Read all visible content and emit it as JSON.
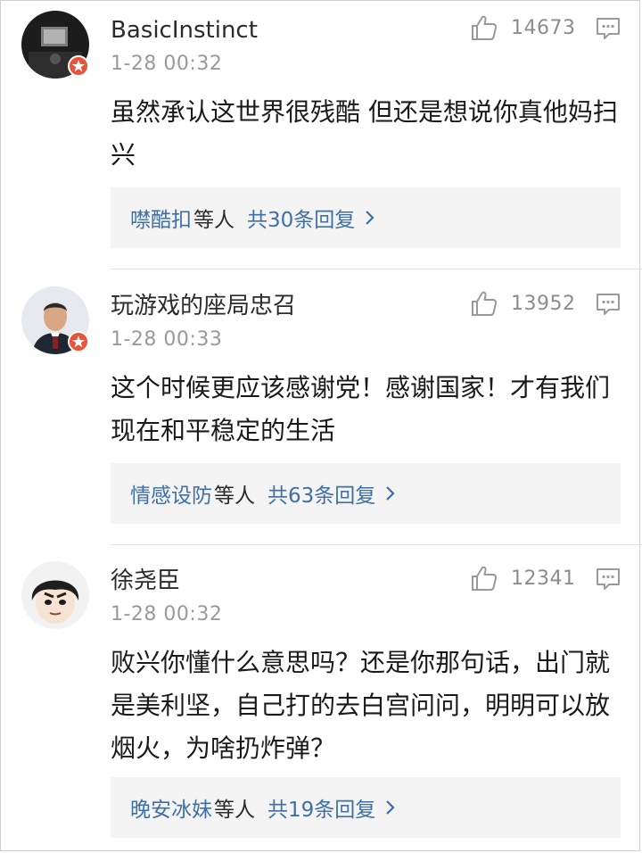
{
  "comments": [
    {
      "username": "BasicInstinct",
      "timestamp": "1-28 00:32",
      "like_count": "14673",
      "content": "虽然承认这世界很残酷 但还是想说你真他妈扫兴",
      "replies_names": "噤酷扣",
      "replies_suffix": "等人",
      "replies_total": "共30条回复"
    },
    {
      "username": "玩游戏的座局忠召",
      "timestamp": "1-28 00:33",
      "like_count": "13952",
      "content": "这个时候更应该感谢党！感谢国家！才有我们现在和平稳定的生活",
      "replies_names": "情感设防",
      "replies_suffix": "等人",
      "replies_total": "共63条回复"
    },
    {
      "username": "徐尧臣",
      "timestamp": "1-28 00:32",
      "like_count": "12341",
      "content": "败兴你懂什么意思吗？还是你那句话，出门就是美利坚，自己打的去白宫问问，明明可以放烟火，为啥扔炸弹？",
      "replies_names": "晚安冰妹",
      "replies_suffix": "等人",
      "replies_total": "共19条回复"
    }
  ],
  "icons": {
    "like": "thumbs-up-icon",
    "reply": "comment-icon",
    "badge": "verified-badge-icon",
    "chevron": "chevron-right-icon"
  },
  "colors": {
    "link": "#3f6fa7",
    "meta": "#9a9a9a",
    "badge": "#e8543a",
    "reply_bg": "#f4f4f4"
  }
}
